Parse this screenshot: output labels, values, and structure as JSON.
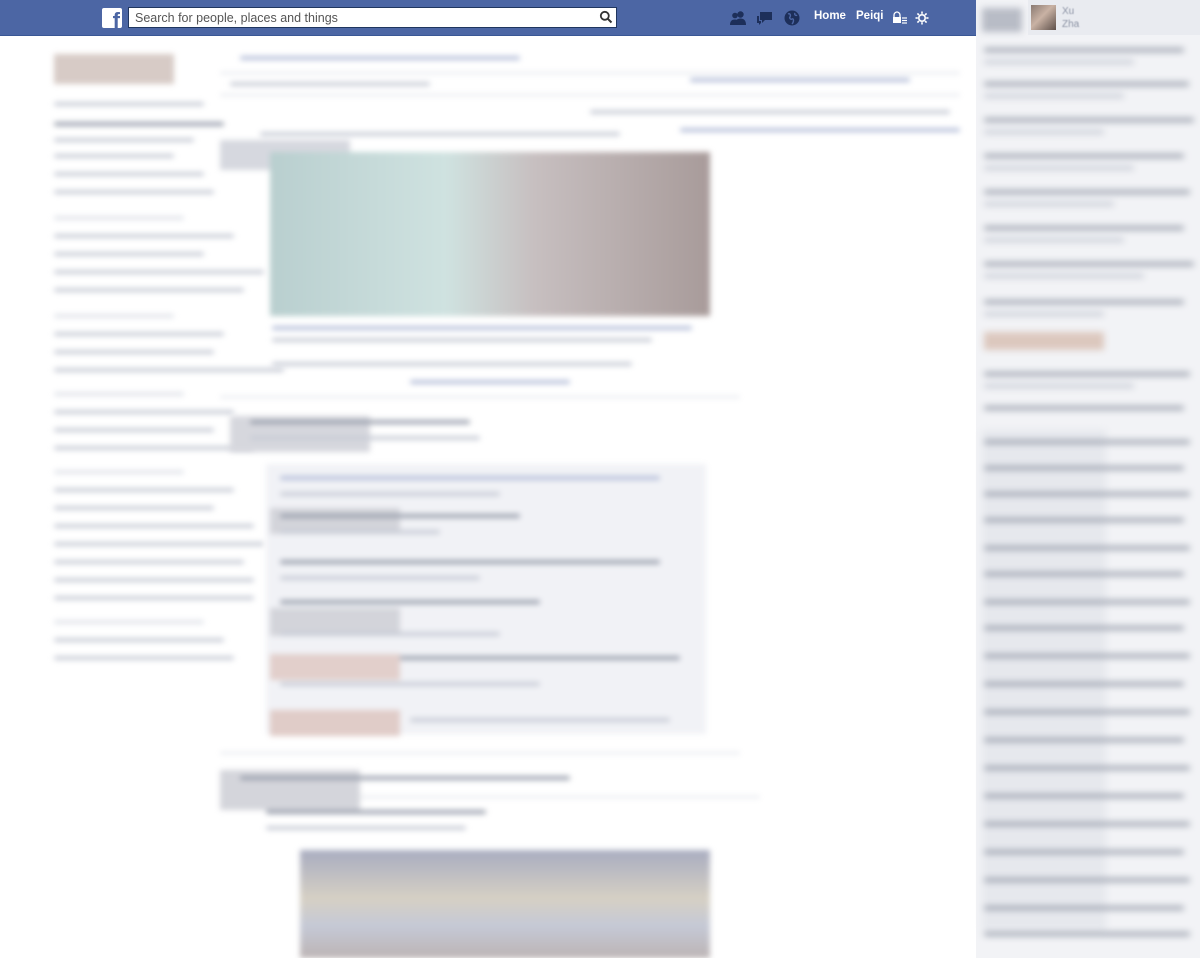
{
  "topbar": {
    "logo_letter": "f",
    "search_placeholder": "Search for people, places and things",
    "nav": {
      "home": "Home",
      "profile": "Peiqi"
    }
  },
  "chat": {
    "self_name_line1": "Xu",
    "self_name_line2": "Zha"
  },
  "colors": {
    "brand_blue": "#4c66a4",
    "brand_blue_dark": "#3a5795",
    "page_bg": "#ffffff",
    "chat_bg": "#f2f3f6"
  },
  "icons": [
    "facebook-logo-icon",
    "search-icon",
    "friend-requests-icon",
    "messages-icon",
    "notifications-globe-icon",
    "privacy-shortcuts-icon",
    "settings-gear-icon"
  ]
}
